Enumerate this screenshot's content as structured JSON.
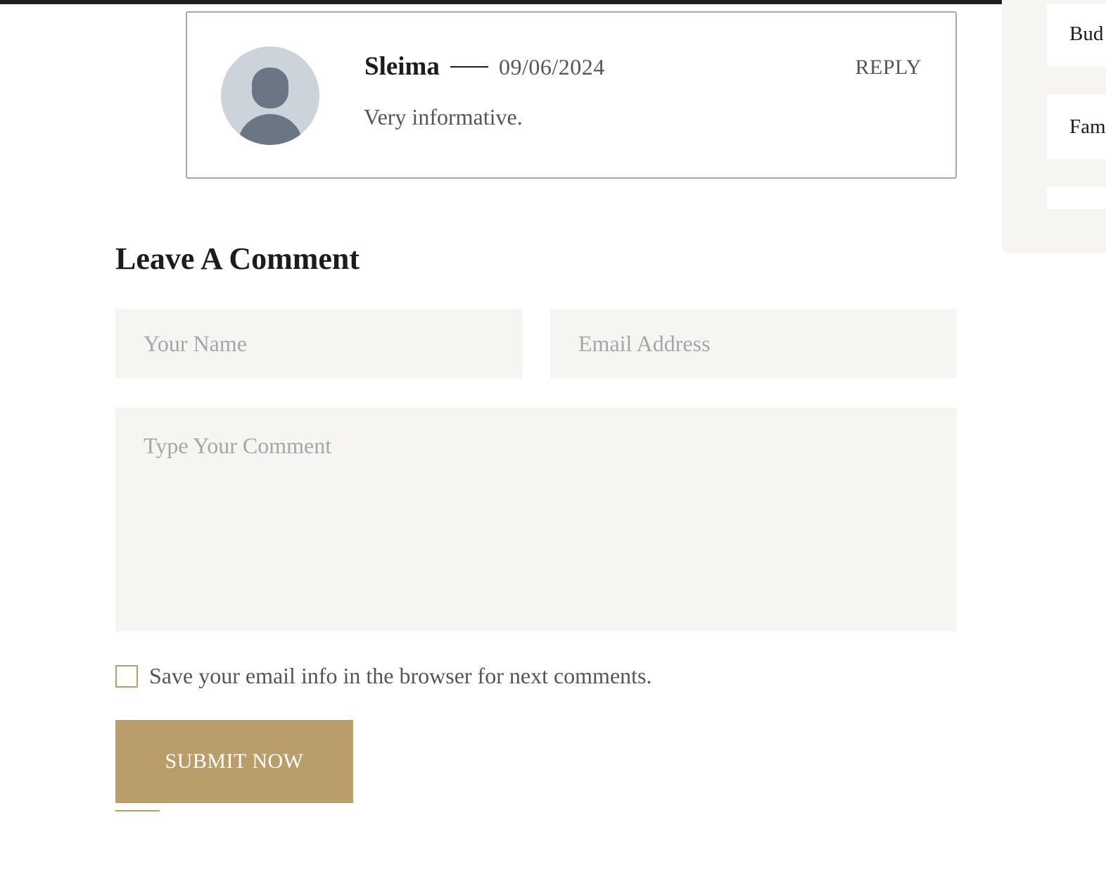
{
  "sidebar": {
    "items": [
      {
        "label": "Bud"
      },
      {
        "label": "Fam"
      },
      {
        "label": ""
      }
    ]
  },
  "comment": {
    "author": "Sleima",
    "date": "09/06/2024",
    "reply_label": "REPLY",
    "text": "Very informative."
  },
  "form": {
    "title": "Leave A Comment",
    "name_placeholder": "Your Name",
    "email_placeholder": "Email Address",
    "comment_placeholder": "Type Your Comment",
    "save_info_label": "Save your email info in the browser for next comments.",
    "submit_label": "SUBMIT NOW"
  },
  "colors": {
    "accent": "#b99d6b",
    "field_bg": "#f6f5f1",
    "avatar_bg": "#cdd3da",
    "avatar_fg": "#6b7685"
  }
}
